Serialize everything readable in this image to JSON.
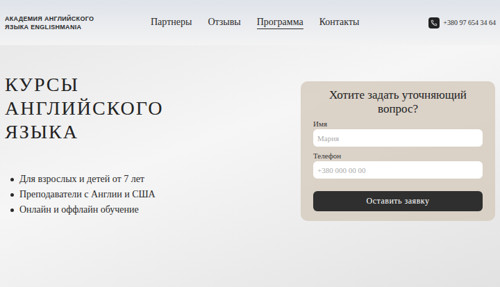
{
  "header": {
    "logo_lines": [
      "АКАДЕМИЯ АНГЛИЙСКОГО",
      "ЯЗЫКА ENGLISHMANIA"
    ],
    "nav": [
      {
        "label": "Партнеры",
        "selected": false
      },
      {
        "label": "Отзывы",
        "selected": false
      },
      {
        "label": "Программа",
        "selected": true
      },
      {
        "label": "Контакты",
        "selected": false
      }
    ],
    "phone": "+380 97 654 34 64"
  },
  "hero": {
    "title_lines": [
      "КУРСЫ",
      "АНГЛИЙСКОГО",
      "ЯЗЫКА"
    ],
    "bullets": [
      "Для взрослых и детей от 7 лет",
      "Преподаватели с Англии и США",
      "Онлайн и оффлайн обучение"
    ]
  },
  "form": {
    "title": "Хотите задать уточняющий вопрос?",
    "fields": [
      {
        "label": "Имя",
        "placeholder": "Мария"
      },
      {
        "label": "Телефон",
        "placeholder": "+380 000 00 00"
      }
    ],
    "button": "Оставить заявку"
  }
}
